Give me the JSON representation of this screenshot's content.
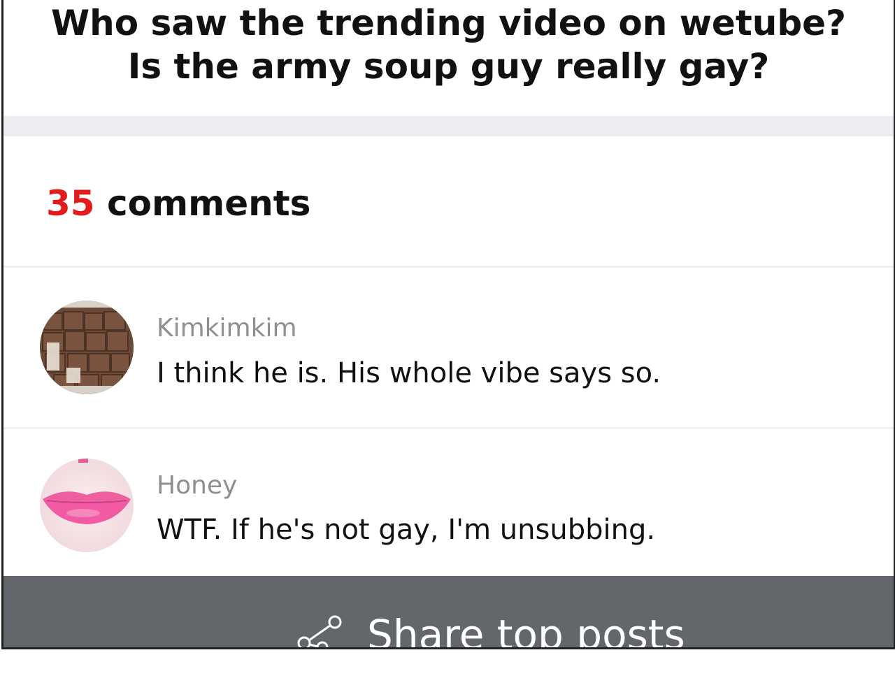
{
  "post": {
    "title_line1": "Who saw the trending video on wetube?",
    "title_line2": "Is the army soup guy really gay?"
  },
  "comments_section": {
    "count": "35",
    "label": "comments",
    "count_color": "#e21b1b"
  },
  "comments": [
    {
      "user": "Kimkimkim",
      "text": "I think he is. His whole vibe says so.",
      "avatar_icon": "brownie-tray-avatar"
    },
    {
      "user": "Honey",
      "text": "WTF. If he's not gay, I'm unsubbing.",
      "avatar_icon": "pink-lips-avatar"
    }
  ],
  "share_bar": {
    "label": "Share top posts",
    "icon": "share-icon",
    "background": "#63676c"
  }
}
